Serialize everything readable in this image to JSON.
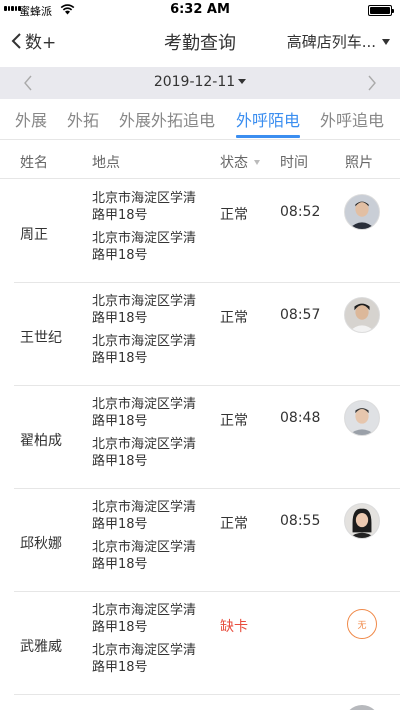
{
  "status_bar": {
    "carrier": "蜜蜂派",
    "time": "6:32 AM"
  },
  "nav": {
    "back_label": "数+",
    "title": "考勤查询",
    "store": "高碑店列车..."
  },
  "date_bar": {
    "date": "2019-12-11"
  },
  "tabs": [
    {
      "label": "外展",
      "active": false
    },
    {
      "label": "外拓",
      "active": false
    },
    {
      "label": "外展外拓追电",
      "active": false
    },
    {
      "label": "外呼陌电",
      "active": true
    },
    {
      "label": "外呼追电",
      "active": false
    }
  ],
  "table": {
    "headers": {
      "name": "姓名",
      "location": "地点",
      "status": "状态",
      "time": "时间",
      "photo": "照片"
    },
    "rows": [
      {
        "name": "周正",
        "address_1": "北京市海淀区学清路甲18号",
        "address_2": "北京市海淀区学清路甲18号",
        "status": "正常",
        "time": "08:52",
        "photo": "avatar-photo"
      },
      {
        "name": "王世纪",
        "address_1": "北京市海淀区学清路甲18号",
        "address_2": "北京市海淀区学清路甲18号",
        "status": "正常",
        "time": "08:57",
        "photo": "avatar-photo"
      },
      {
        "name": "翟柏成",
        "address_1": "北京市海淀区学清路甲18号",
        "address_2": "北京市海淀区学清路甲18号",
        "status": "正常",
        "time": "08:48",
        "photo": "avatar-photo"
      },
      {
        "name": "邱秋娜",
        "address_1": "北京市海淀区学清路甲18号",
        "address_2": "北京市海淀区学清路甲18号",
        "status": "正常",
        "time": "08:55",
        "photo": "avatar-photo"
      },
      {
        "name": "武雅威",
        "address_1": "北京市海淀区学清路甲18号",
        "address_2": "北京市海淀区学清路甲18号",
        "status": "缺卡",
        "time": "",
        "photo_placeholder": "无"
      }
    ]
  },
  "colors": {
    "accent": "#3b8ef0",
    "warning": "#e84c3d",
    "no_photo": "#f08a4a"
  }
}
